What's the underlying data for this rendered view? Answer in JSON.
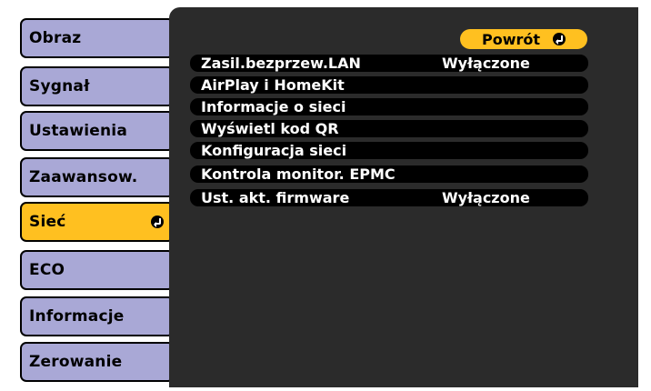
{
  "sidebar": {
    "items": [
      {
        "label": "Obraz"
      },
      {
        "label": "Sygnał"
      },
      {
        "label": "Ustawienia"
      },
      {
        "label": "Zaawansow."
      },
      {
        "label": "Sieć",
        "active": true
      },
      {
        "label": "ECO"
      },
      {
        "label": "Informacje"
      },
      {
        "label": "Zerowanie"
      }
    ]
  },
  "panel": {
    "back_label": "Powrót",
    "rows": [
      {
        "label": "Zasil.bezprzew.LAN",
        "value": "Wyłączone"
      },
      {
        "label": "AirPlay i HomeKit",
        "value": ""
      },
      {
        "label": "Informacje o sieci",
        "value": ""
      },
      {
        "label": "Wyświetl kod QR",
        "value": ""
      },
      {
        "label": "Konfiguracja sieci",
        "value": ""
      },
      {
        "label": "Kontrola monitor. EPMC",
        "value": ""
      },
      {
        "label": "Ust. akt. firmware",
        "value": "Wyłączone"
      }
    ]
  },
  "colors": {
    "sidebar_bg": "#a9a8d6",
    "active_bg": "#ffc020",
    "panel_bg": "#2b2b2b",
    "row_bg": "#000000",
    "text_light": "#ffffff"
  },
  "icons": {
    "enter": "enter-icon"
  }
}
